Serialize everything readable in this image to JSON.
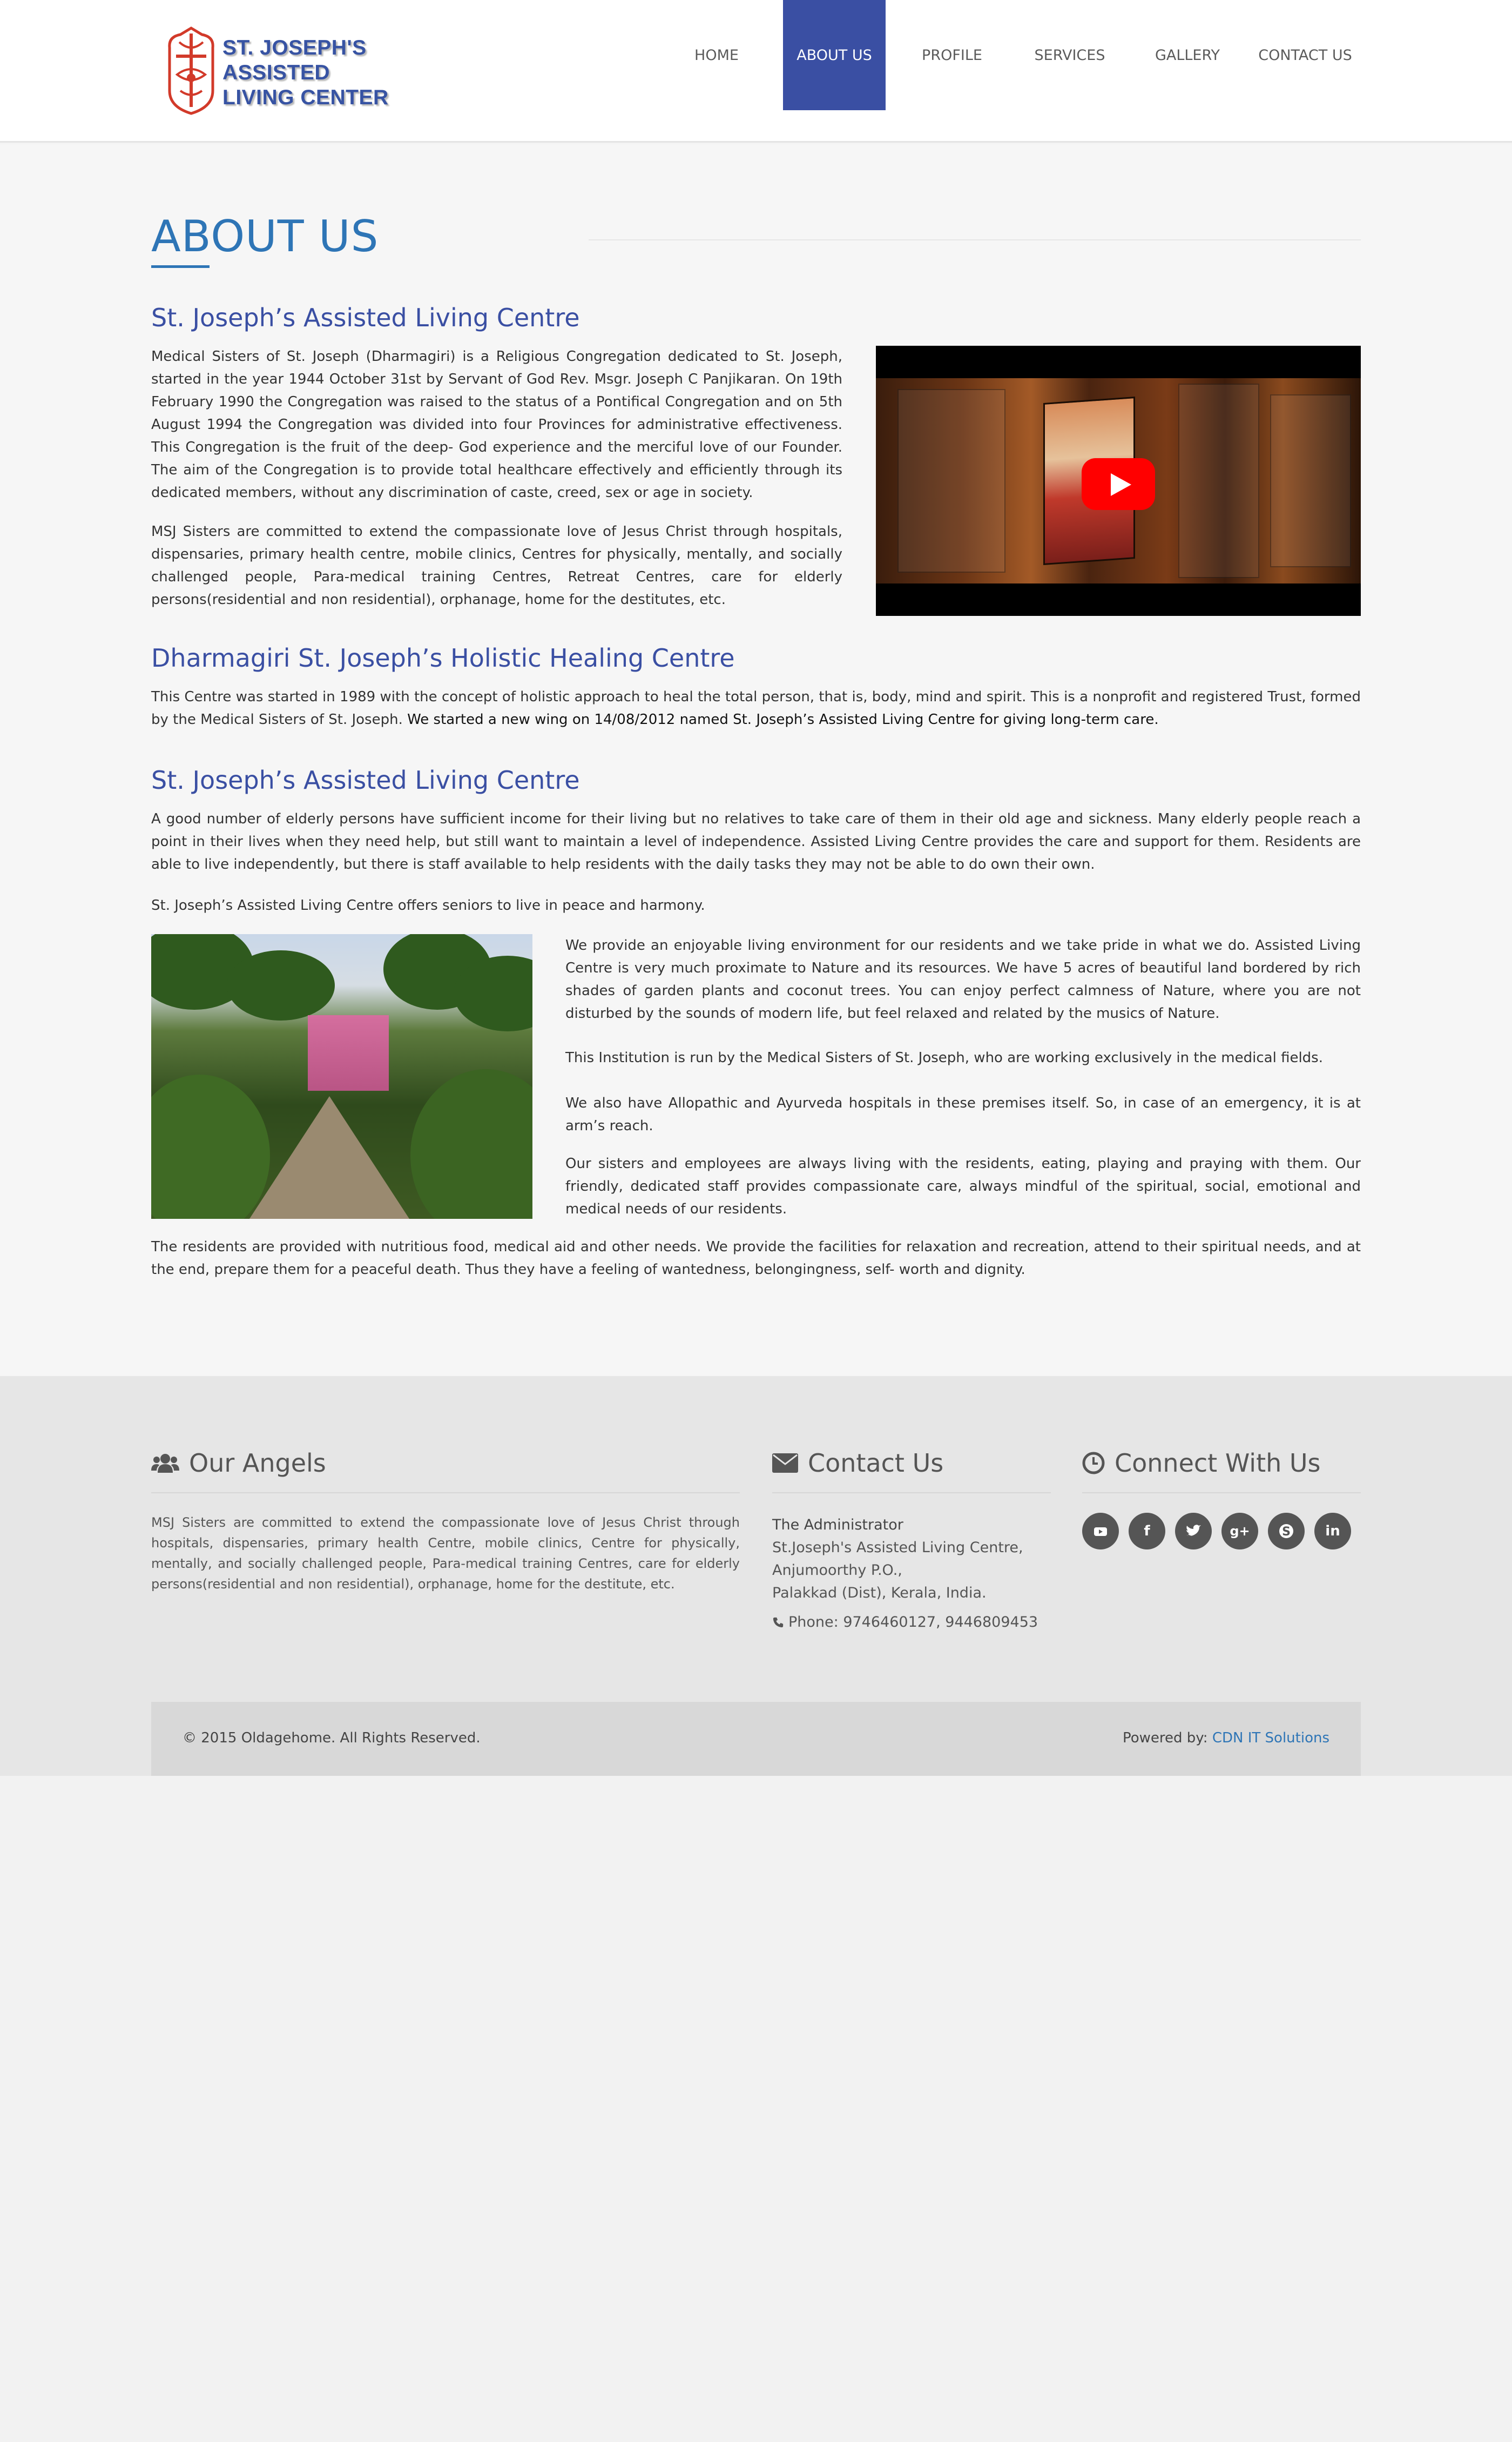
{
  "brand": {
    "line1": "ST. JOSEPH'S",
    "line2": "ASSISTED",
    "line3": "LIVING CENTER"
  },
  "nav": {
    "items": [
      "HOME",
      "ABOUT US",
      "PROFILE",
      "SERVICES",
      "GALLERY",
      "CONTACT US"
    ],
    "active": "ABOUT US"
  },
  "page": {
    "title": "ABOUT US",
    "section1": {
      "heading": "St. Joseph’s Assisted Living Centre",
      "para1": "Medical Sisters of St. Joseph (Dharmagiri) is a Religious Congregation dedicated to St. Joseph, started in the year 1944 October 31st by Servant of God Rev. Msgr. Joseph C Panjikaran. On 19th February 1990 the Congregation was raised to the status of a Pontifical Congregation and on 5th August 1994 the Congregation was divided into four Provinces for administrative effectiveness. This Congregation is the fruit of the deep- God experience and the merciful love of our Founder. The aim of the Congregation is to provide total healthcare effectively and efficiently through its dedicated members, without any discrimination of caste, creed, sex or age in society.",
      "para2": "MSJ Sisters are committed to extend the compassionate love of Jesus Christ through hospitals, dispensaries, primary health centre, mobile clinics, Centres for physically, mentally, and socially challenged people, Para-medical training Centres, Retreat Centres, care for elderly persons(residential and non residential), orphanage, home for the destitutes, etc."
    },
    "section2": {
      "heading": "Dharmagiri St. Joseph’s Holistic Healing Centre",
      "para_a": "This Centre was started in 1989 with the concept of holistic approach to heal the total person, that is, body, mind and spirit. This is a nonprofit and registered Trust, formed by the Medical Sisters of St. Joseph. ",
      "para_b": "We started a new wing on 14/08/2012 named St. Joseph’s Assisted Living Centre for giving long-term care."
    },
    "section3": {
      "heading": "St. Joseph’s Assisted Living Centre",
      "para1": "A good number of elderly persons have sufficient income for their living but no relatives to take care of them in their old age and sickness. Many elderly people reach a point in their lives when they need help, but still want to maintain a level of independence. Assisted Living Centre provides the care and support for them. Residents are able to live independently, but there is staff available to help residents with the daily tasks they may not be able to do own their own.",
      "para2": "St. Joseph’s Assisted Living Centre offers seniors to live in peace and harmony.",
      "right1": "We provide an enjoyable living environment for our residents and we take pride in what we do. Assisted Living Centre is very much proximate to Nature and its resources. We have 5 acres of beautiful land bordered by rich shades of garden plants and coconut trees. You can enjoy perfect calmness of Nature, where you are not disturbed by the sounds of modern life, but feel relaxed and related by the musics of Nature.",
      "right2": "This Institution is run by the Medical Sisters of St. Joseph, who are working exclusively in the medical fields.",
      "right3": "We also have Allopathic and Ayurveda hospitals in these premises itself. So, in case of an emergency, it is at arm’s reach.",
      "right4": "Our sisters and employees are always living with the residents, eating, playing and praying with them. Our friendly, dedicated staff provides compassionate care, always mindful of the spiritual, social, emotional and medical needs of our residents.",
      "para3": "The residents are provided with nutritious food, medical aid and other needs. We provide the facilities for relaxation and recreation, attend to their spiritual needs, and at the end, prepare them for a peaceful death. Thus they have a feeling of wantedness, belongingness, self- worth and dignity."
    }
  },
  "footer": {
    "angels": {
      "heading": "Our Angels",
      "text": "MSJ Sisters are committed to extend the compassionate love of Jesus Christ through hospitals, dispensaries, primary health Centre, mobile clinics, Centre for physically, mentally, and socially challenged people, Para-medical training Centres, care for elderly persons(residential and non residential), orphanage, home for the destitute, etc."
    },
    "contact": {
      "heading": "Contact Us",
      "name": "The Administrator",
      "line1": "St.Joseph's Assisted Living Centre,",
      "line2": "Anjumoorthy P.O.,",
      "line3": "Palakkad (Dist), Kerala, India.",
      "phone": "Phone: 9746460127, 9446809453"
    },
    "connect": {
      "heading": "Connect With Us",
      "icons": [
        "youtube-icon",
        "facebook-icon",
        "twitter-icon",
        "google-plus-icon",
        "skype-icon",
        "linkedin-icon"
      ]
    },
    "copyright": "© 2015 Oldagehome. All Rights Reserved.",
    "powered_label": "Powered by: ",
    "powered_link": "CDN IT Solutions"
  },
  "colors": {
    "accent": "#3a4fa3",
    "title_blue": "#2e75b6",
    "youtube_red": "#ff0000"
  }
}
